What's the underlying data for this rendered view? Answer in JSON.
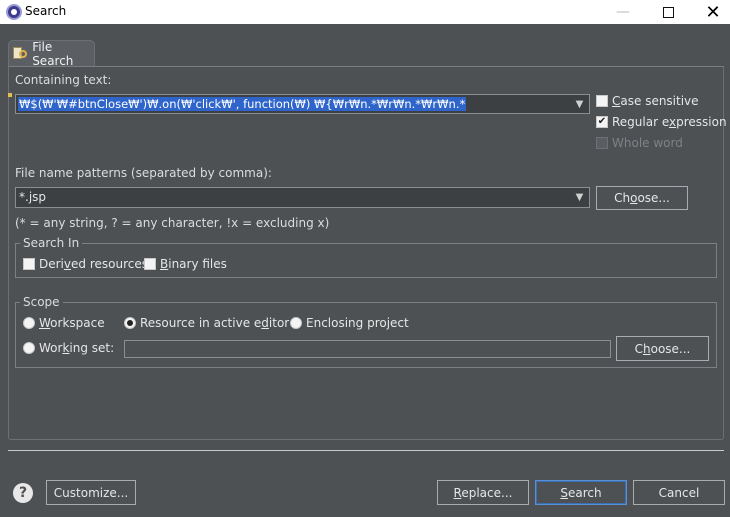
{
  "window": {
    "title": "Search"
  },
  "tab": {
    "label": "File Search"
  },
  "containing": {
    "label": "Containing text:",
    "value": "₩$(₩'₩#btnClose₩')₩.on(₩'click₩', function(₩) ₩{₩r₩n.*₩r₩n.*₩r₩n.*"
  },
  "options": {
    "case_sensitive": {
      "label": "Case sensitive",
      "checked": false
    },
    "regular_expression": {
      "label": "Regular expression",
      "checked": true
    },
    "whole_word": {
      "label": "Whole word",
      "checked": false,
      "disabled": true
    }
  },
  "patterns": {
    "label": "File name patterns (separated by comma):",
    "value": "*.jsp",
    "choose_label": "Choose...",
    "hint": "(* = any string, ? = any character, !x = excluding x)"
  },
  "search_in": {
    "title": "Search In",
    "derived": {
      "label": "Derived resources",
      "checked": false
    },
    "binary": {
      "label": "Binary files",
      "checked": false
    }
  },
  "scope": {
    "title": "Scope",
    "workspace": {
      "label": "Workspace",
      "selected": false
    },
    "active_editor": {
      "label": "Resource in active editor",
      "selected": true
    },
    "enclosing": {
      "label": "Enclosing project",
      "selected": false
    },
    "working_set": {
      "label": "Working set:",
      "selected": false,
      "value": ""
    },
    "choose_label": "Choose..."
  },
  "footer": {
    "customize_label": "Customize...",
    "replace_label": "Replace...",
    "search_label": "Search",
    "cancel_label": "Cancel"
  }
}
